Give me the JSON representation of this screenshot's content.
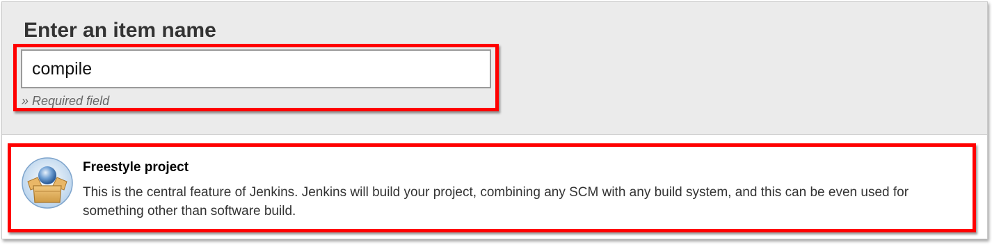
{
  "form": {
    "heading": "Enter an item name",
    "item_name_value": "compile",
    "required_note": "» Required field"
  },
  "item_types": [
    {
      "title": "Freestyle project",
      "description": "This is the central feature of Jenkins. Jenkins will build your project, combining any SCM with any build system, and this can be even used for something other than software build.",
      "icon": "freestyle-project-icon"
    }
  ],
  "colors": {
    "highlight": "#ff0000",
    "panel_background": "#ebebeb"
  }
}
